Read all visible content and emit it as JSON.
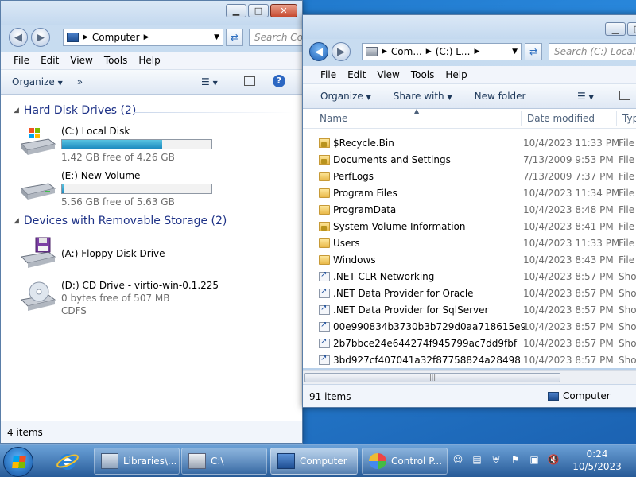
{
  "left_window": {
    "address": {
      "path": [
        "Computer"
      ]
    },
    "search_placeholder": "Search Co",
    "menu": [
      "File",
      "Edit",
      "View",
      "Tools",
      "Help"
    ],
    "toolbar": {
      "organize": "Organize",
      "more": "»"
    },
    "groups": [
      {
        "title": "Hard Disk Drives (2)",
        "drives": [
          {
            "name": "(C:) Local Disk",
            "free": "1.42 GB free of 4.26 GB",
            "used_fraction": 0.67,
            "icon": "windows-drive-icon"
          },
          {
            "name": "(E:) New Volume",
            "free": "5.56 GB free of 5.63 GB",
            "used_fraction": 0.01,
            "icon": "hard-drive-icon"
          }
        ]
      },
      {
        "title": "Devices with Removable Storage (2)",
        "drives": [
          {
            "name": "(A:) Floppy Disk Drive",
            "icon": "floppy-drive-icon"
          },
          {
            "name": "(D:) CD Drive - virtio-win-0.1.225",
            "free": "0 bytes free of 507 MB",
            "fs": "CDFS",
            "icon": "cd-drive-icon"
          }
        ]
      }
    ],
    "status": "4 items"
  },
  "right_window": {
    "address": {
      "path": [
        "Com...",
        "(C:) L..."
      ]
    },
    "search_placeholder": "Search (C:) Local Disk",
    "menu": [
      "File",
      "Edit",
      "View",
      "Tools",
      "Help"
    ],
    "toolbar": {
      "organize": "Organize",
      "share": "Share with",
      "new_folder": "New folder"
    },
    "columns": {
      "name": "Name",
      "date": "Date modified",
      "type": "Typ"
    },
    "files": [
      {
        "name": "$Recycle.Bin",
        "date": "10/4/2023 11:33 PM",
        "type": "File",
        "kind": "locked-folder"
      },
      {
        "name": "Documents and Settings",
        "date": "7/13/2009 9:53 PM",
        "type": "File",
        "kind": "locked-folder"
      },
      {
        "name": "PerfLogs",
        "date": "7/13/2009 7:37 PM",
        "type": "File",
        "kind": "folder"
      },
      {
        "name": "Program Files",
        "date": "10/4/2023 11:34 PM",
        "type": "File",
        "kind": "folder"
      },
      {
        "name": "ProgramData",
        "date": "10/4/2023 8:48 PM",
        "type": "File",
        "kind": "folder"
      },
      {
        "name": "System Volume Information",
        "date": "10/4/2023 8:41 PM",
        "type": "File",
        "kind": "locked-folder"
      },
      {
        "name": "Users",
        "date": "10/4/2023 11:33 PM",
        "type": "File",
        "kind": "folder"
      },
      {
        "name": "Windows",
        "date": "10/4/2023 8:43 PM",
        "type": "File",
        "kind": "folder"
      },
      {
        "name": ".NET CLR Networking",
        "date": "10/4/2023 8:57 PM",
        "type": "Sho",
        "kind": "shortcut"
      },
      {
        "name": ".NET Data Provider for Oracle",
        "date": "10/4/2023 8:57 PM",
        "type": "Sho",
        "kind": "shortcut"
      },
      {
        "name": ".NET Data Provider for SqlServer",
        "date": "10/4/2023 8:57 PM",
        "type": "Sho",
        "kind": "shortcut"
      },
      {
        "name": "00e990834b3730b3b729d0aa718615e9",
        "date": "10/4/2023 8:57 PM",
        "type": "Sho",
        "kind": "shortcut"
      },
      {
        "name": "2b7bbce24e644274f945799ac7dd9fbf",
        "date": "10/4/2023 8:57 PM",
        "type": "Sho",
        "kind": "shortcut"
      },
      {
        "name": "3bd927cf407041a32f87758824a28498",
        "date": "10/4/2023 8:57 PM",
        "type": "Sho",
        "kind": "shortcut"
      }
    ],
    "status_count": "91 items",
    "status_location": "Computer"
  },
  "taskbar": {
    "items": [
      {
        "label": "Libraries\\...",
        "icon": "libraries-icon"
      },
      {
        "label": "C:\\",
        "icon": "drive-icon"
      },
      {
        "label": "Computer",
        "icon": "computer-icon"
      },
      {
        "label": "Control P...",
        "icon": "control-panel-icon"
      }
    ],
    "time": "0:24",
    "date": "10/5/2023"
  }
}
